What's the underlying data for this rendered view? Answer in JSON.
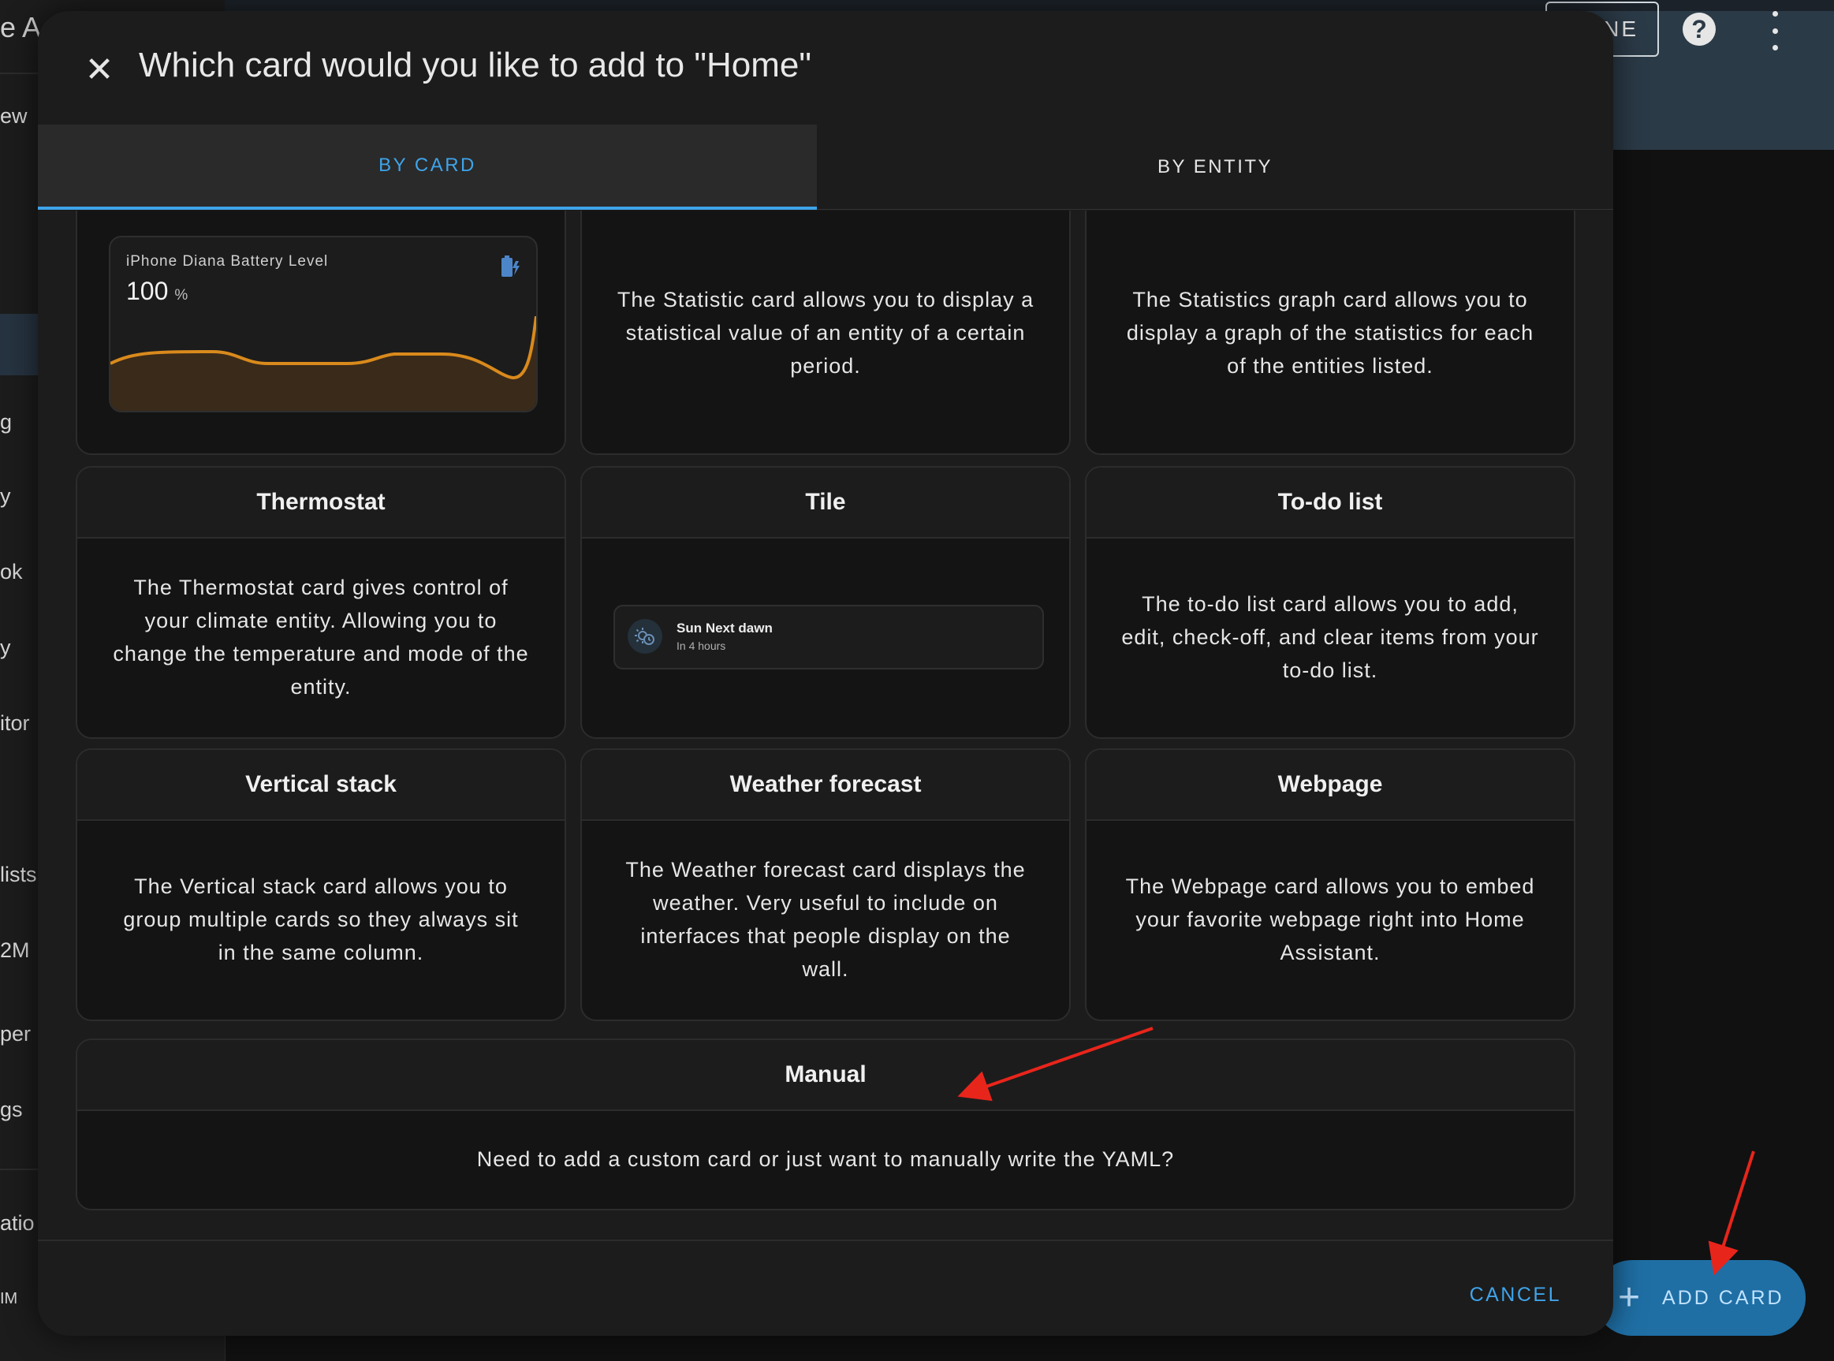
{
  "background": {
    "sidebar_title": "e A",
    "sidebar_items": [
      "ew",
      "g",
      "y",
      "ok",
      "y",
      "itor",
      "lists",
      "2M",
      "per",
      "gs",
      "atio",
      "IM"
    ],
    "done_label": "NE",
    "help_icon": "help-circle-icon",
    "more_icon": "dots-vertical-icon",
    "fab_label": "ADD CARD",
    "fab_icon": "plus-icon"
  },
  "dialog": {
    "title": "Which card would you like to add to \"Home\"",
    "close_icon": "close-icon",
    "tabs": [
      {
        "label": "BY CARD",
        "active": true
      },
      {
        "label": "BY ENTITY",
        "active": false
      }
    ],
    "cards": [
      {
        "title": "",
        "preview": "battery-graph",
        "preview_name": "iPhone Diana Battery Level",
        "preview_value": "100",
        "preview_unit": "%"
      },
      {
        "title": "",
        "description": "The Statistic card allows you to display a statistical value of an entity of a certain period."
      },
      {
        "title": "",
        "description": "The Statistics graph card allows you to display a graph of the statistics for each of the entities listed."
      },
      {
        "title": "Thermostat",
        "description": "The Thermostat card gives control of your climate entity. Allowing you to change the temperature and mode of the entity."
      },
      {
        "title": "Tile",
        "preview": "tile",
        "tile_name": "Sun Next dawn",
        "tile_state": "In 4 hours"
      },
      {
        "title": "To-do list",
        "description": "The to-do list card allows you to add, edit, check-off, and clear items from your to-do list."
      },
      {
        "title": "Vertical stack",
        "description": "The Vertical stack card allows you to group multiple cards so they always sit in the same column."
      },
      {
        "title": "Weather forecast",
        "description": "The Weather forecast card displays the weather. Very useful to include on interfaces that people display on the wall."
      },
      {
        "title": "Webpage",
        "description": "The Webpage card allows you to embed your favorite webpage right into Home Assistant."
      }
    ],
    "manual": {
      "title": "Manual",
      "description": "Need to add a custom card or just want to manually write the YAML?"
    },
    "cancel_label": "CANCEL"
  },
  "colors": {
    "accent": "#3fa4ea",
    "annotation_arrow": "#e8251b",
    "graph_line": "#d98a1c"
  }
}
